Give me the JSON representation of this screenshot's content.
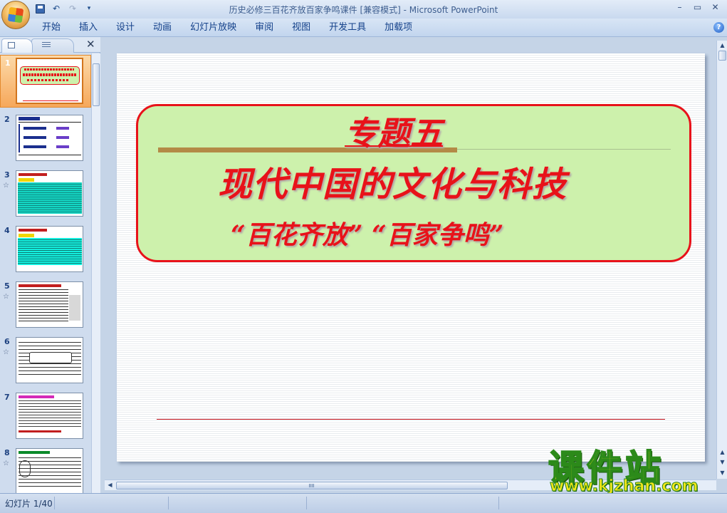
{
  "window": {
    "title": "历史必修三百花齐放百家争鸣课件 [兼容模式] - Microsoft PowerPoint",
    "controls": [
      "–",
      "▭",
      "✕"
    ]
  },
  "quick_access": {
    "icons": [
      "save-icon",
      "undo-icon",
      "redo-icon",
      "customize-icon"
    ],
    "undo_glyph": "↶",
    "redo_glyph": "↷",
    "more_glyph": "▾"
  },
  "ribbon": {
    "tabs": [
      "开始",
      "插入",
      "设计",
      "动画",
      "幻灯片放映",
      "审阅",
      "视图",
      "开发工具",
      "加载项"
    ],
    "help_glyph": "?"
  },
  "panel": {
    "close_glyph": "✕"
  },
  "thumbnails": [
    {
      "number": "1",
      "star": false
    },
    {
      "number": "2",
      "star": false
    },
    {
      "number": "3",
      "star": true
    },
    {
      "number": "4",
      "star": false
    },
    {
      "number": "5",
      "star": true
    },
    {
      "number": "6",
      "star": true
    },
    {
      "number": "7",
      "star": false
    },
    {
      "number": "8",
      "star": true
    }
  ],
  "star_glyph": "☆",
  "slide": {
    "title1": "专题五",
    "title2": "现代中国的文化与科技",
    "subtitle": "“百花齐放” “百家争鸣”",
    "colors": {
      "text": "#e8121a",
      "box_fill": "#cdf1ac",
      "box_border": "#e8121a"
    }
  },
  "status": {
    "slide_indicator": "幻灯片 1/40"
  },
  "watermark": {
    "title": "课件站",
    "url": "www.kjzhan.com"
  }
}
